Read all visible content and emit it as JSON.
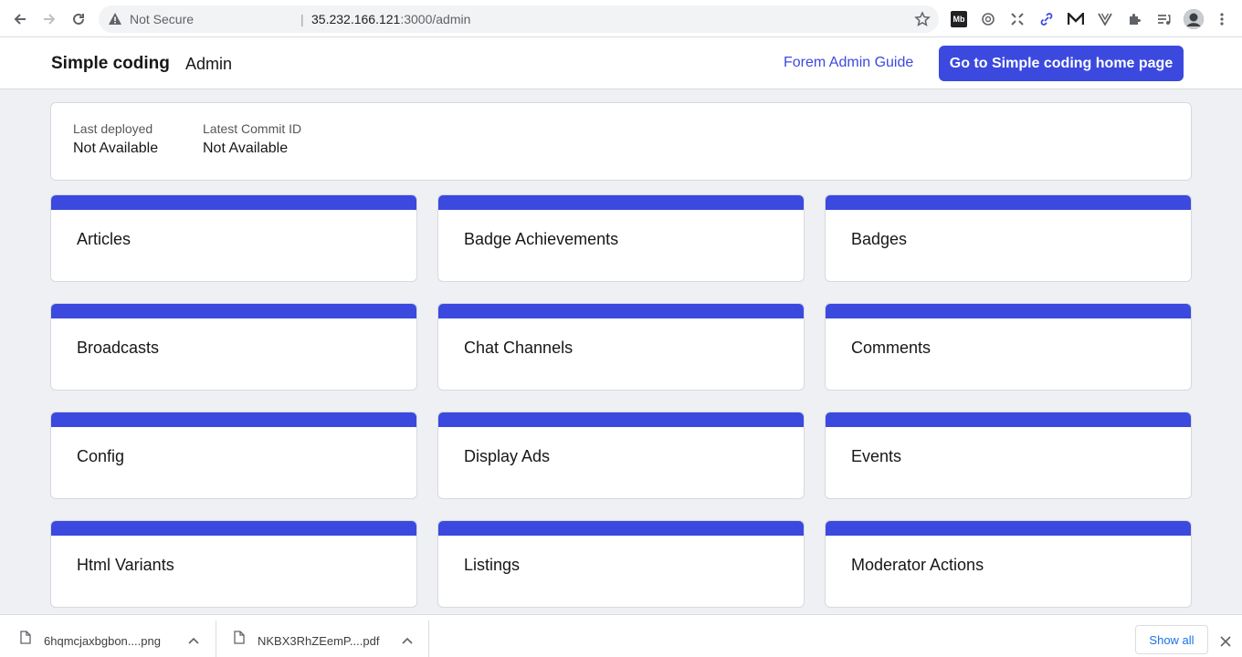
{
  "browser": {
    "security_label": "Not Secure",
    "url_separator": "|",
    "url_host": "35.232.166.121",
    "url_rest": ":3000/admin",
    "extensions": [
      "mb-extension-icon",
      "openai-icon",
      "scan-icon",
      "link-icon",
      "medium-icon",
      "vue-icon",
      "puzzle-icon",
      "media-list-icon"
    ],
    "mb_label": "Mb"
  },
  "header": {
    "brand": "Simple coding",
    "section": "Admin",
    "guide_link": "Forem Admin Guide",
    "home_button": "Go to Simple coding home page"
  },
  "deploy": {
    "last_deployed_label": "Last deployed",
    "last_deployed_value": "Not Available",
    "commit_label": "Latest Commit ID",
    "commit_value": "Not Available"
  },
  "tiles": [
    "Articles",
    "Badge Achievements",
    "Badges",
    "Broadcasts",
    "Chat Channels",
    "Comments",
    "Config",
    "Display Ads",
    "Events",
    "Html Variants",
    "Listings",
    "Moderator Actions"
  ],
  "downloads": {
    "items": [
      {
        "name": "6hqmcjaxbgbon....png"
      },
      {
        "name": "NKBX3RhZEemP....pdf"
      }
    ],
    "show_all": "Show all"
  },
  "colors": {
    "accent": "#3b49df",
    "page_bg": "#eef0f3"
  }
}
